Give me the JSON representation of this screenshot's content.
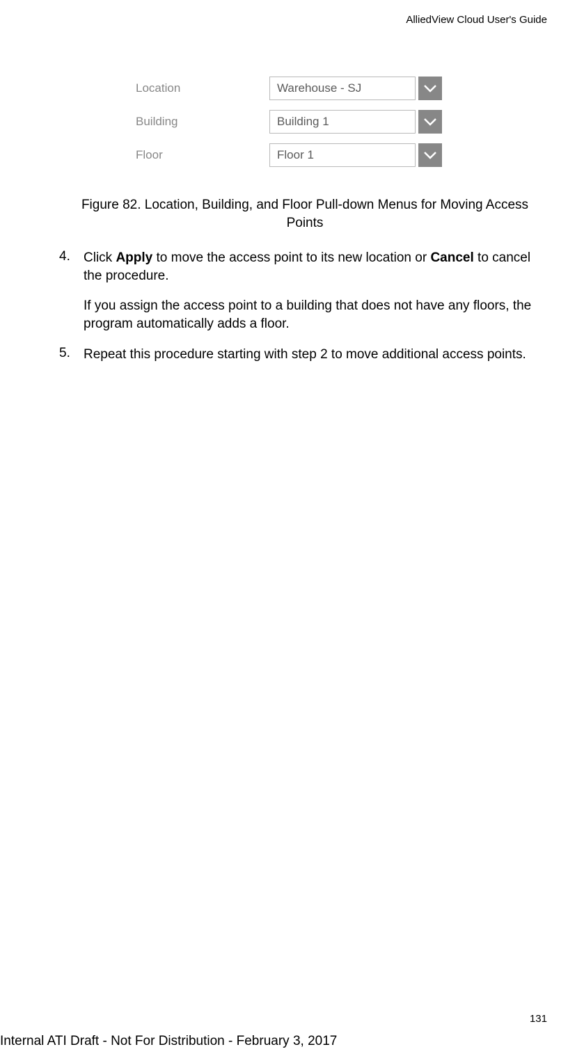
{
  "header": "AlliedView Cloud User's Guide",
  "dropdowns": {
    "location": {
      "label": "Location",
      "value": "Warehouse - SJ"
    },
    "building": {
      "label": "Building",
      "value": "Building 1"
    },
    "floor": {
      "label": "Floor",
      "value": "Floor 1"
    }
  },
  "figure_caption": "Figure 82. Location, Building, and Floor Pull-down Menus for Moving Access Points",
  "steps": {
    "four": {
      "num": "4.",
      "part1": "Click ",
      "bold1": "Apply",
      "part2": " to move the access point to its new location or ",
      "bold2": "Cancel",
      "part3": " to cancel the procedure.",
      "para2": "If you assign the access point to a building that does not have any floors, the program automatically adds a floor."
    },
    "five": {
      "num": "5.",
      "text": "Repeat this procedure starting with step 2 to move additional access points."
    }
  },
  "page_number": "131",
  "footer": "Internal ATI Draft - Not For Distribution - February 3, 2017"
}
